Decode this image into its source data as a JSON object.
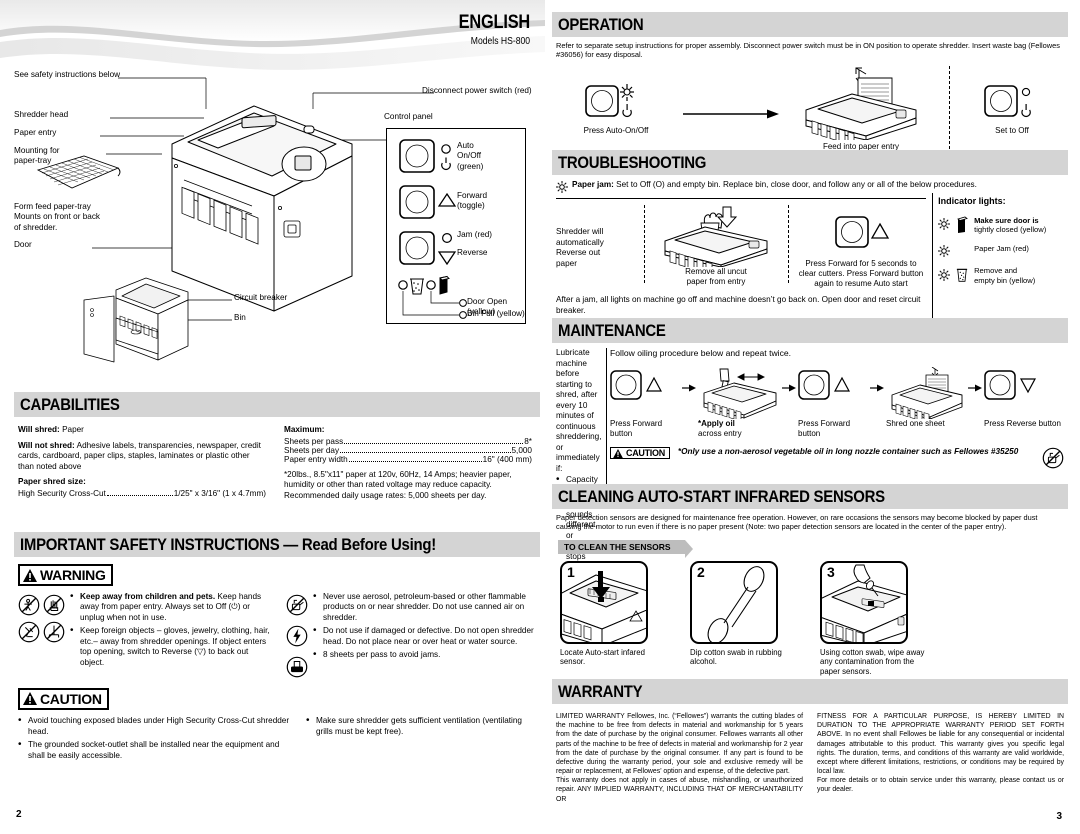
{
  "header": {
    "language": "ENGLISH",
    "models": "Models HS-800"
  },
  "diagram": {
    "labels": [
      "See safety instructions below",
      "Shredder head",
      "Paper entry",
      "Mounting for\npaper-tray",
      "Form feed paper-tray\nMounts on front or back\nof shredder.",
      "Door",
      "Circuit breaker",
      "Bin",
      "Disconnect power switch (red)",
      "Control panel"
    ],
    "label_see_safety": "See safety instructions below",
    "label_shredder_head": "Shredder head",
    "label_paper_entry": "Paper entry",
    "label_mounting": "Mounting for\npaper-tray",
    "label_tray": "Form feed paper-tray\nMounts on front or back\nof shredder.",
    "label_door": "Door",
    "label_circuit_breaker": "Circuit breaker",
    "label_bin": "Bin",
    "label_disconnect": "Disconnect power switch (red)",
    "label_control_panel": "Control panel",
    "panel": {
      "auto_on_off": "Auto\nOn/Off\n(green)",
      "forward": "Forward\n(toggle)",
      "jam": "Jam (red)",
      "reverse": "Reverse",
      "door_open": "Door Open (yellow)",
      "bin_full": "Bin Full (yellow)"
    }
  },
  "capabilities": {
    "title": "CAPABILITIES",
    "will_shred_label": "Will shred:",
    "will_shred_value": "Paper",
    "will_not_shred_label": "Will not shred:",
    "will_not_shred_value": "Adhesive labels, transparencies, newspaper, credit cards, cardboard, paper clips, staples, laminates or plastic other than noted above",
    "paper_shred_size_label": "Paper shred size:",
    "shred_type": "High Security Cross-Cut",
    "shred_size": "1/25\" x 3/16\" (1 x 4.7mm)",
    "maximum_label": "Maximum:",
    "rows": [
      {
        "name": "Sheets per pass",
        "value": "8*"
      },
      {
        "name": "Sheets per day",
        "value": "5,000"
      },
      {
        "name": "Paper entry width",
        "value": "16\" (400 mm)"
      }
    ],
    "footnote": "*20lbs., 8.5\"x11\" paper at 120v, 60Hz, 14 Amps; heavier paper, humidity or other than rated voltage may reduce capacity. Recommended daily usage rates: 5,000 sheets per day."
  },
  "safety": {
    "title": "IMPORTANT SAFETY INSTRUCTIONS — Read Before Using!",
    "warning_label": "WARNING",
    "caution_label": "CAUTION",
    "warning_left": [
      "Keep away from children and pets. Keep hands away from paper entry. Always set to Off (⏻) or unplug when not in use.",
      "Keep foreign objects – gloves, jewelry, clothing, hair, etc.– away from shredder openings. If object enters top opening, switch to Reverse (▽) to back out object."
    ],
    "warning_left_bold": [
      "Keep away from children and pets.",
      ""
    ],
    "warning_right": [
      "Never use aerosol, petroleum-based or other flammable products on or near shredder. Do not use canned air on shredder.",
      "Do not use if damaged or defective. Do not open shredder head. Do not place near or over heat or water source.",
      "8 sheets per pass to avoid jams."
    ],
    "caution_left": [
      "Avoid touching exposed blades under High Security Cross-Cut shredder head.",
      "The grounded socket-outlet shall be installed near the equipment and shall be easily accessible."
    ],
    "caution_right": [
      "Make sure shredder gets sufficient ventilation (ventilating grills must be kept free)."
    ]
  },
  "operation": {
    "title": "OPERATION",
    "intro": "Refer to separate setup instructions for proper assembly. Disconnect power switch must be in ON position to operate shredder. Insert waste bag (Fellowes #36056) for easy disposal.",
    "step1": "Press Auto-On/Off",
    "step2": "Feed into paper entry\nand release",
    "step3": "Set to Off"
  },
  "troubleshooting": {
    "title": "TROUBLESHOOTING",
    "jam_label": "Paper jam:",
    "jam_text": "Set to Off (O) and empty bin. Replace bin, close door, and follow any or all of the below procedures.",
    "step1": "Shredder will\nautomatically\nReverse out\npaper",
    "step2": "Remove all uncut\npaper from entry",
    "step3": "Press Forward for 5 seconds to clear cutters. Press Forward button again to resume Auto start",
    "footer": "After a jam, all lights on machine go off and machine doesn’t go back on. Open door and reset circuit breaker.",
    "indicator_title": "Indicator lights:",
    "indicators": [
      {
        "bold": "Make sure door is",
        "rest": "tightly closed (yellow)"
      },
      {
        "bold": "",
        "rest": "Paper Jam (red)"
      },
      {
        "bold": "",
        "rest": "Remove and\nempty bin (yellow)"
      }
    ]
  },
  "maintenance": {
    "title": "MAINTENANCE",
    "left_text": "Lubricate machine before starting to shred, after every 10 minutes of continuous shreddering, or immediately if:",
    "left_bullets": [
      "Capacity decreases",
      "Motor sounds different, or shredder stops running"
    ],
    "intro": "Follow oiling procedure below and repeat twice.",
    "steps": [
      "Press Forward\nbutton",
      "*Apply oil",
      "across entry",
      "Press Forward\nbutton",
      "Shred one sheet",
      "Press Reverse button"
    ],
    "step1": "Press Forward\nbutton",
    "step2_bold": "*Apply oil",
    "step2_rest": "across entry",
    "step3": "Press Forward\nbutton",
    "step4": "Shred one sheet",
    "step5": "Press Reverse button",
    "caution_label": "CAUTION",
    "caution_text": "*Only use a non-aerosol vegetable oil in long nozzle container such as Fellowes #35250"
  },
  "sensors": {
    "title": "CLEANING AUTO-START INFRARED SENSORS",
    "intro": "Paper detection sensors are designed for maintenance free operation. However, on rare occasions the sensors may become blocked by paper dust causing the motor to run even if there is no paper present (Note: two paper detection sensors are located in the center of the paper entry).",
    "tag": "TO CLEAN THE SENSORS",
    "steps": [
      {
        "num": "1",
        "caption": "Locate Auto-start infared\nsensor."
      },
      {
        "num": "2",
        "caption": "Dip cotton swab in rubbing\nalcohol."
      },
      {
        "num": "3",
        "caption": "Using cotton swab, wipe away\nany contamination from the\npaper sensors."
      }
    ]
  },
  "warranty": {
    "title": "WARRANTY",
    "left": "LIMITED WARRANTY Fellowes, Inc. (“Fellowes”) warrants the cutting blades of the machine to be free from defects in material and workmanship for 5 years from the date of purchase by the original consumer. Fellowes warrants all other parts of the machine to be free of defects in material and workmanship for 2 year from the date of purchase by the original consumer. If any part is found to be defective during the warranty period, your sole and exclusive remedy will be repair or replacement, at Fellowes’ option and expense, of the defective part.\nThis warranty does not apply in cases of abuse, mishandling, or unauthorized repair. ANY IMPLIED WARRANTY, INCLUDING THAT OF MERCHANTABILITY OR",
    "right": "FITNESS FOR A PARTICULAR PURPOSE, IS HEREBY LIMITED IN DURATION TO THE APPROPRIATE WARRANTY PERIOD SET FORTH ABOVE. In no event shall Fellowes be liable for any consequential or incidental damages attributable to this product. This warranty gives you specific legal rights. The duration, terms, and conditions of this warranty are valid worldwide, except where different limitations, restrictions, or conditions may be required by local law.\nFor more details or to obtain service under this warranty, please contact us or your dealer."
  },
  "page_numbers": {
    "left": "2",
    "right": "3"
  }
}
